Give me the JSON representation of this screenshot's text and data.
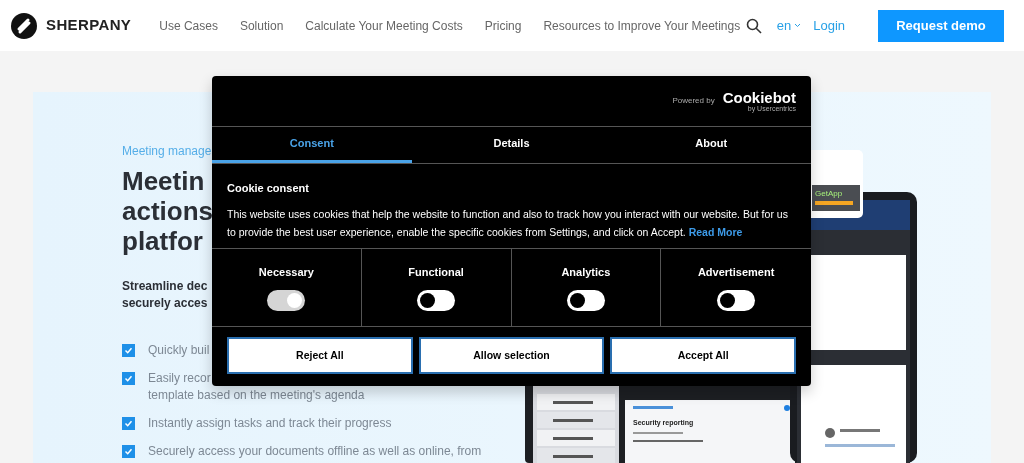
{
  "nav": {
    "brand": "SHERPANY",
    "links": [
      "Use Cases",
      "Solution",
      "Calculate Your Meeting Costs",
      "Pricing",
      "Resources to Improve Your Meetings"
    ],
    "language": "en",
    "login": "Login",
    "cta": "Request demo"
  },
  "hero": {
    "eyebrow": "Meeting manage",
    "title_lines": [
      "Meetin",
      "actions",
      "platfor"
    ],
    "subtitle_lines": [
      "Streamline dec",
      "securely acces"
    ],
    "features": [
      {
        "lines": [
          "Quickly buil"
        ],
        "checked": true
      },
      {
        "lines": [
          "Easily recor",
          "template based on the meeting's agenda"
        ],
        "checked": true
      },
      {
        "lines": [
          "Instantly assign tasks and track their progress"
        ],
        "checked": true
      },
      {
        "lines": [
          "Securely access your documents offline as well as online, from"
        ],
        "checked": true
      }
    ]
  },
  "screens": {
    "agenda_title": "Security reporting",
    "badge": "GetApp"
  },
  "cookie_dialog": {
    "powered_by": "Powered by",
    "provider": "Cookiebot",
    "provider_sub": "by Usercentrics",
    "tabs": [
      {
        "label": "Consent",
        "selected": true
      },
      {
        "label": "Details",
        "selected": false
      },
      {
        "label": "About",
        "selected": false
      }
    ],
    "heading": "Cookie consent",
    "body": "This website uses cookies that help the website to function and also to track how you interact with our website. But for us to provide the best user experience, enable the specific cookies from Settings, and click on Accept.",
    "read_more": "Read More",
    "categories": [
      {
        "label": "Necessary",
        "on": true,
        "disabled": true
      },
      {
        "label": "Functional",
        "on": false,
        "disabled": false
      },
      {
        "label": "Analytics",
        "on": false,
        "disabled": false
      },
      {
        "label": "Advertisement",
        "on": false,
        "disabled": false
      }
    ],
    "buttons": [
      "Reject All",
      "Allow selection",
      "Accept All"
    ]
  }
}
